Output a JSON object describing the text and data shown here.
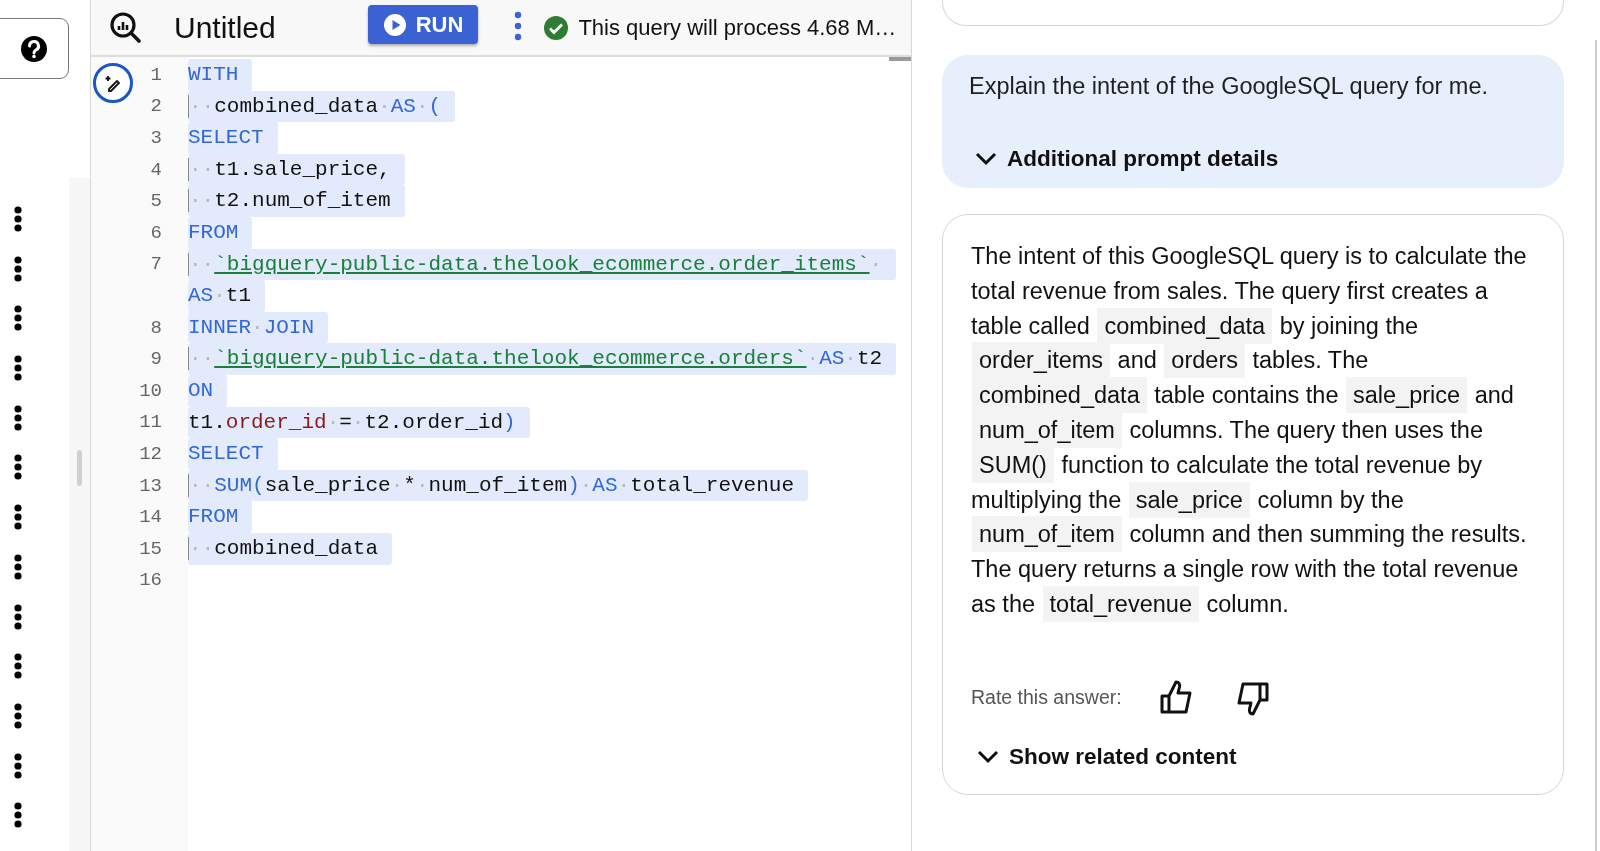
{
  "editor": {
    "title": "Untitled",
    "run_button": {
      "label": "RUN"
    },
    "status": {
      "text": "This query will process 4.68 M…",
      "valid": true
    },
    "lines": [
      {
        "number": "1",
        "selected": true,
        "rows": [
          [
            {
              "kind": "keyword",
              "text": "WITH"
            }
          ]
        ]
      },
      {
        "number": "2",
        "selected": true,
        "rows": [
          [
            {
              "kind": "space",
              "text": "··"
            },
            {
              "kind": "plain",
              "text": "combined_data"
            },
            {
              "kind": "space",
              "text": "·"
            },
            {
              "kind": "keyword",
              "text": "AS"
            },
            {
              "kind": "space",
              "text": "·"
            },
            {
              "kind": "keyword",
              "text": "("
            }
          ]
        ]
      },
      {
        "number": "3",
        "selected": true,
        "rows": [
          [
            {
              "kind": "keyword",
              "text": "SELECT"
            }
          ]
        ]
      },
      {
        "number": "4",
        "selected": true,
        "rows": [
          [
            {
              "kind": "space",
              "text": "··"
            },
            {
              "kind": "plain",
              "text": "t1.sale_price,"
            }
          ]
        ]
      },
      {
        "number": "5",
        "selected": true,
        "rows": [
          [
            {
              "kind": "space",
              "text": "··"
            },
            {
              "kind": "plain",
              "text": "t2.num_of_item"
            }
          ]
        ]
      },
      {
        "number": "6",
        "selected": true,
        "rows": [
          [
            {
              "kind": "keyword",
              "text": "FROM"
            }
          ]
        ]
      },
      {
        "number": "7",
        "selected": true,
        "rows": [
          [
            {
              "kind": "space",
              "text": "··"
            },
            {
              "kind": "table",
              "text": "`bigquery-public-data.thelook_ecommerce.order_items`"
            },
            {
              "kind": "space",
              "text": "·"
            }
          ]
        ],
        "continuation": [
          {
            "kind": "keyword",
            "text": "AS"
          },
          {
            "kind": "space",
            "text": "·"
          },
          {
            "kind": "plain",
            "text": "t1"
          }
        ]
      },
      {
        "number": "8",
        "selected": true,
        "rows": [
          [
            {
              "kind": "keyword",
              "text": "INNER"
            },
            {
              "kind": "space",
              "text": "·"
            },
            {
              "kind": "keyword",
              "text": "JOIN"
            }
          ]
        ]
      },
      {
        "number": "9",
        "selected": true,
        "rows": [
          [
            {
              "kind": "space",
              "text": "··"
            },
            {
              "kind": "table",
              "text": "`bigquery-public-data.thelook_ecommerce.orders`"
            },
            {
              "kind": "space",
              "text": "·"
            },
            {
              "kind": "keyword",
              "text": "AS"
            },
            {
              "kind": "space",
              "text": "·"
            },
            {
              "kind": "plain",
              "text": "t2"
            }
          ]
        ]
      },
      {
        "number": "10",
        "selected": true,
        "rows": [
          [
            {
              "kind": "keyword",
              "text": "ON"
            }
          ]
        ]
      },
      {
        "number": "11",
        "selected": true,
        "rows": [
          [
            {
              "kind": "plain",
              "text": "t1."
            },
            {
              "kind": "field",
              "text": "order_id"
            },
            {
              "kind": "space",
              "text": "·"
            },
            {
              "kind": "plain",
              "text": "="
            },
            {
              "kind": "space",
              "text": "·"
            },
            {
              "kind": "plain",
              "text": "t2.order_id"
            },
            {
              "kind": "keyword",
              "text": ")"
            }
          ]
        ]
      },
      {
        "number": "12",
        "selected": true,
        "rows": [
          [
            {
              "kind": "keyword",
              "text": "SELECT"
            }
          ]
        ]
      },
      {
        "number": "13",
        "selected": true,
        "rows": [
          [
            {
              "kind": "space",
              "text": "··"
            },
            {
              "kind": "keyword",
              "text": "SUM("
            },
            {
              "kind": "plain",
              "text": "sale_price"
            },
            {
              "kind": "space",
              "text": "·"
            },
            {
              "kind": "plain",
              "text": "*"
            },
            {
              "kind": "space",
              "text": "·"
            },
            {
              "kind": "plain",
              "text": "num_of_item"
            },
            {
              "kind": "keyword",
              "text": ")"
            },
            {
              "kind": "space",
              "text": "·"
            },
            {
              "kind": "keyword",
              "text": "AS"
            },
            {
              "kind": "space",
              "text": "·"
            },
            {
              "kind": "plain",
              "text": "total_revenue"
            }
          ]
        ]
      },
      {
        "number": "14",
        "selected": true,
        "rows": [
          [
            {
              "kind": "keyword",
              "text": "FROM"
            }
          ]
        ]
      },
      {
        "number": "15",
        "selected": true,
        "rows": [
          [
            {
              "kind": "space",
              "text": "··"
            },
            {
              "kind": "plain",
              "text": "combined_data"
            }
          ]
        ]
      },
      {
        "number": "16",
        "selected": false,
        "rows": [
          []
        ]
      }
    ]
  },
  "assistant": {
    "prompt": {
      "text": "Explain the intent of the GoogleSQL query for me.",
      "details_toggle": {
        "label": "Additional prompt details",
        "expanded": false
      }
    },
    "answer": {
      "segments": [
        {
          "kind": "text",
          "text": "The intent of this GoogleSQL query is to calculate the total revenue from sales. The query first creates a table called "
        },
        {
          "kind": "code",
          "text": "combined_data"
        },
        {
          "kind": "text",
          "text": " by joining the "
        },
        {
          "kind": "code",
          "text": "order_items"
        },
        {
          "kind": "text",
          "text": " and "
        },
        {
          "kind": "code",
          "text": "orders"
        },
        {
          "kind": "text",
          "text": " tables. The "
        },
        {
          "kind": "code",
          "text": "combined_data"
        },
        {
          "kind": "text",
          "text": " table contains the "
        },
        {
          "kind": "code",
          "text": "sale_price"
        },
        {
          "kind": "text",
          "text": " and "
        },
        {
          "kind": "code",
          "text": "num_of_item"
        },
        {
          "kind": "text",
          "text": " columns. The query then uses the "
        },
        {
          "kind": "code",
          "text": "SUM()"
        },
        {
          "kind": "text",
          "text": " function to calculate the total revenue by multiplying the "
        },
        {
          "kind": "code",
          "text": "sale_price"
        },
        {
          "kind": "text",
          "text": " column by the "
        },
        {
          "kind": "code",
          "text": "num_of_item"
        },
        {
          "kind": "text",
          "text": " column and then summing the results. The query returns a single row with the total revenue as the "
        },
        {
          "kind": "code",
          "text": "total_revenue"
        },
        {
          "kind": "text",
          "text": " column."
        }
      ],
      "rating_label": "Rate this answer:",
      "related_toggle": {
        "label": "Show related content",
        "expanded": false
      }
    }
  }
}
